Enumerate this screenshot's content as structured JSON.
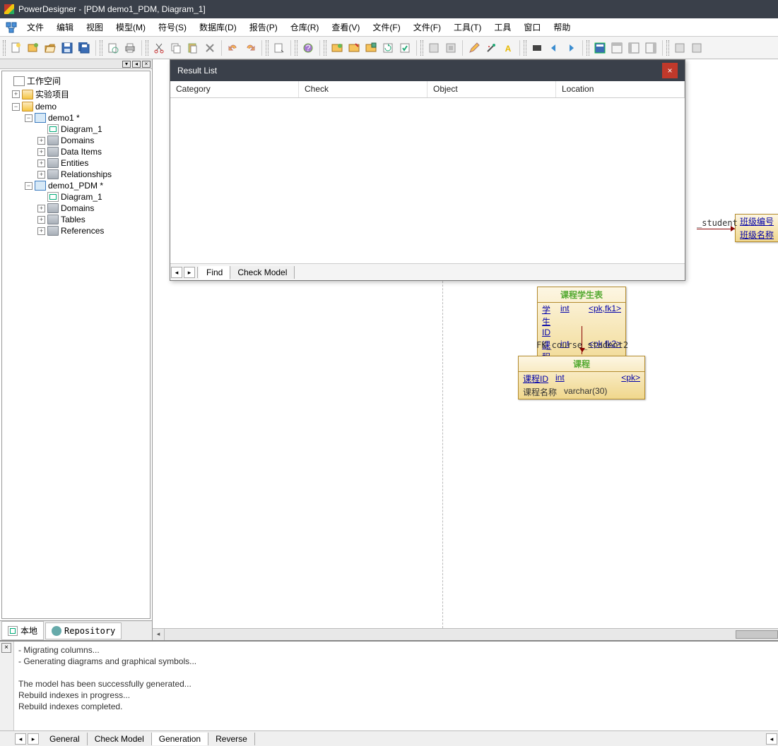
{
  "title": "PowerDesigner - [PDM demo1_PDM, Diagram_1]",
  "menu": [
    "文件",
    "编辑",
    "视图",
    "模型(M)",
    "符号(S)",
    "数据库(D)",
    "报告(P)",
    "仓库(R)",
    "查看(V)",
    "文件(F)",
    "文件(F)",
    "工具(T)",
    "工具",
    "窗口",
    "帮助"
  ],
  "tree": {
    "root": "工作空间",
    "n1": "实验项目",
    "n2": "demo",
    "n3": "demo1 *",
    "n3a": "Diagram_1",
    "n3b": "Domains",
    "n3c": "Data Items",
    "n3d": "Entities",
    "n3e": "Relationships",
    "n4": "demo1_PDM *",
    "n4a": "Diagram_1",
    "n4b": "Domains",
    "n4c": "Tables",
    "n4d": "References"
  },
  "sidebar_tabs": {
    "local": "本地",
    "repo": "Repository"
  },
  "result_list": {
    "title": "Result List",
    "cols": [
      "Category",
      "Check",
      "Object",
      "Location"
    ],
    "tabs": [
      "Find",
      "Check Model"
    ]
  },
  "rel_labels": {
    "a": "_student",
    "b": "FK_course_student2"
  },
  "entity1": {
    "title": "课程学生表",
    "r1c1": "学生ID",
    "r1c2": "int",
    "r1c3": "<pk,fk1>",
    "r2c1": "课程ID",
    "r2c2": "int",
    "r2c3": "<pk,fk2>"
  },
  "entity2": {
    "title": "课程",
    "r1c1": "课程ID",
    "r1c2": "int",
    "r1c3": "<pk>",
    "r2c1": "课程名称",
    "r2c2": "varchar(30)",
    "r2c3": ""
  },
  "entity3": {
    "r1": "班级编号",
    "r2": "班级名称"
  },
  "output": {
    "lines": "   - Migrating columns...\n   - Generating diagrams and graphical symbols...\n\nThe model has been successfully generated...\nRebuild indexes in progress...\nRebuild indexes completed.",
    "tabs": [
      "General",
      "Check Model",
      "Generation",
      "Reverse"
    ]
  }
}
